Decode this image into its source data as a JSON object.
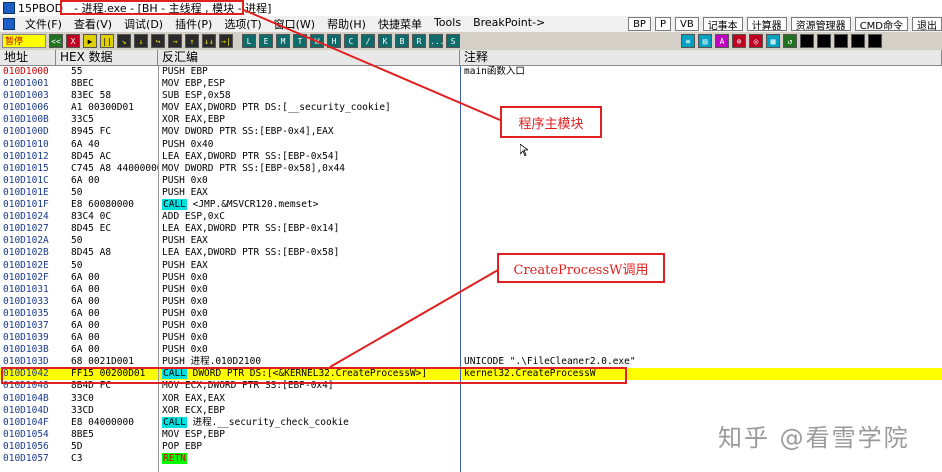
{
  "titlebar": {
    "app": "15PBOD",
    "process": "- 进程.exe - [BH - 主线程 , 模块 - 进程]"
  },
  "menu": {
    "items": [
      "文件(F)",
      "查看(V)",
      "调试(D)",
      "插件(P)",
      "选项(T)",
      "窗口(W)",
      "帮助(H)",
      "快捷菜单",
      "Tools",
      "BreakPoint->"
    ],
    "right_buttons": [
      "BP",
      "P",
      "VB",
      "记事本",
      "计算器",
      "资源管理器",
      "CMD命令",
      "退出"
    ]
  },
  "toolbar": {
    "status": "暂停",
    "buttons": [
      "<<",
      "X",
      "▶",
      "||",
      "↘",
      "↓",
      "↪",
      "→",
      "↑",
      "↓↓",
      "→|"
    ],
    "letters": [
      "L",
      "E",
      "M",
      "T",
      "W",
      "H",
      "C",
      "/",
      "K",
      "B",
      "R",
      "...",
      "S"
    ],
    "right_icons": [
      "≡",
      "▤",
      "A",
      "⊕",
      "◎",
      "▦",
      "↺"
    ]
  },
  "columns": {
    "address": "地址",
    "hex": "HEX 数据",
    "disasm": "反汇编",
    "comment": "注释"
  },
  "rows": [
    {
      "addr": "010D1000",
      "hex": "55",
      "dis": "PUSH EBP",
      "cmt": "main函数入口"
    },
    {
      "addr": "010D1001",
      "hex": "8BEC",
      "dis": "MOV EBP,ESP",
      "cmt": ""
    },
    {
      "addr": "010D1003",
      "hex": "83EC 58",
      "dis": "SUB ESP,0x58",
      "cmt": ""
    },
    {
      "addr": "010D1006",
      "hex": "A1 00300D01",
      "dis": "MOV EAX,DWORD PTR DS:[__security_cookie]",
      "cmt": ""
    },
    {
      "addr": "010D100B",
      "hex": "33C5",
      "dis": "XOR EAX,EBP",
      "cmt": ""
    },
    {
      "addr": "010D100D",
      "hex": "8945 FC",
      "dis": "MOV DWORD PTR SS:[EBP-0x4],EAX",
      "cmt": ""
    },
    {
      "addr": "010D1010",
      "hex": "6A 40",
      "dis": "PUSH 0x40",
      "cmt": ""
    },
    {
      "addr": "010D1012",
      "hex": "8D45 AC",
      "dis": "LEA EAX,DWORD PTR SS:[EBP-0x54]",
      "cmt": ""
    },
    {
      "addr": "010D1015",
      "hex": "C745 A8 44000000",
      "dis": "MOV DWORD PTR SS:[EBP-0x58],0x44",
      "cmt": ""
    },
    {
      "addr": "010D101C",
      "hex": "6A 00",
      "dis": "PUSH 0x0",
      "cmt": ""
    },
    {
      "addr": "010D101E",
      "hex": "50",
      "dis": "PUSH EAX",
      "cmt": ""
    },
    {
      "addr": "010D101F",
      "hex": "E8 60080000",
      "dis_kw": "CALL",
      "dis": " <JMP.&MSVCR120.memset>",
      "cmt": ""
    },
    {
      "addr": "010D1024",
      "hex": "83C4 0C",
      "dis": "ADD ESP,0xC",
      "cmt": ""
    },
    {
      "addr": "010D1027",
      "hex": "8D45 EC",
      "dis": "LEA EAX,DWORD PTR SS:[EBP-0x14]",
      "cmt": ""
    },
    {
      "addr": "010D102A",
      "hex": "50",
      "dis": "PUSH EAX",
      "cmt": ""
    },
    {
      "addr": "010D102B",
      "hex": "8D45 A8",
      "dis": "LEA EAX,DWORD PTR SS:[EBP-0x58]",
      "cmt": ""
    },
    {
      "addr": "010D102E",
      "hex": "50",
      "dis": "PUSH EAX",
      "cmt": ""
    },
    {
      "addr": "010D102F",
      "hex": "6A 00",
      "dis": "PUSH 0x0",
      "cmt": ""
    },
    {
      "addr": "010D1031",
      "hex": "6A 00",
      "dis": "PUSH 0x0",
      "cmt": ""
    },
    {
      "addr": "010D1033",
      "hex": "6A 00",
      "dis": "PUSH 0x0",
      "cmt": ""
    },
    {
      "addr": "010D1035",
      "hex": "6A 00",
      "dis": "PUSH 0x0",
      "cmt": ""
    },
    {
      "addr": "010D1037",
      "hex": "6A 00",
      "dis": "PUSH 0x0",
      "cmt": ""
    },
    {
      "addr": "010D1039",
      "hex": "6A 00",
      "dis": "PUSH 0x0",
      "cmt": ""
    },
    {
      "addr": "010D103B",
      "hex": "6A 00",
      "dis": "PUSH 0x0",
      "cmt": ""
    },
    {
      "addr": "010D103D",
      "hex": "68 0021D001",
      "dis": "PUSH 进程.010D2100",
      "cmt": "UNICODE \".\\FileCleaner2.0.exe\""
    },
    {
      "addr": "010D1042",
      "hex": "FF15 00200D01",
      "dis_kw": "CALL",
      "dis": " DWORD PTR DS:[<&KERNEL32.CreateProcessW>]",
      "cmt": "kernel32.CreateProcessW",
      "selected": true
    },
    {
      "addr": "010D1048",
      "hex": "8B4D FC",
      "dis": "MOV ECX,DWORD PTR SS:[EBP-0x4]",
      "cmt": ""
    },
    {
      "addr": "010D104B",
      "hex": "33C0",
      "dis": "XOR EAX,EAX",
      "cmt": ""
    },
    {
      "addr": "010D104D",
      "hex": "33CD",
      "dis": "XOR ECX,EBP",
      "cmt": ""
    },
    {
      "addr": "010D104F",
      "hex": "E8 04000000",
      "dis_kw": "CALL",
      "dis": " 进程.__security_check_cookie",
      "cmt": ""
    },
    {
      "addr": "010D1054",
      "hex": "8BE5",
      "dis": "MOV ESP,EBP",
      "cmt": ""
    },
    {
      "addr": "010D1056",
      "hex": "5D",
      "dis": "POP EBP",
      "cmt": ""
    },
    {
      "addr": "010D1057",
      "hex": "C3",
      "dis_kw": "RETN",
      "dis": "",
      "cmt": ""
    }
  ],
  "annotations": {
    "main_module": "程序主模块",
    "create_process": "CreateProcessW调用"
  },
  "watermark": "知乎 @看雪学院",
  "colors": {
    "selected_row": "#ffff00",
    "annotation_red": "#e02020",
    "call_highlight": "#00e0e0",
    "retn_highlight": "#00ff00"
  }
}
